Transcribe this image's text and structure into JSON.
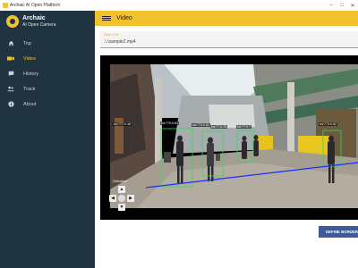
{
  "window": {
    "title": "Archaic AI Open Platform"
  },
  "brand": {
    "name": "Archaic",
    "subtitle": "AI Open Camera"
  },
  "nav": {
    "items": [
      {
        "label": "Top",
        "icon": "home-icon"
      },
      {
        "label": "Video",
        "icon": "video-icon",
        "active": true
      },
      {
        "label": "History",
        "icon": "chat-icon"
      },
      {
        "label": "Track",
        "icon": "people-icon"
      },
      {
        "label": "About",
        "icon": "info-icon"
      }
    ]
  },
  "topbar": {
    "title": "Video"
  },
  "video_file": {
    "label": "Video File",
    "value": ".\\.\\sample2.mp4"
  },
  "detections": [
    {
      "label": "bd:777:0.48"
    },
    {
      "label": "bd:779:0.81"
    },
    {
      "label": "bd:770:0.81"
    },
    {
      "label": "bd:77:0.75"
    },
    {
      "label": "bd:77:0.7"
    },
    {
      "label": "bd:773:0.62"
    }
  ],
  "direction": {
    "label": "Direction"
  },
  "buttons": {
    "define_border": "DEFINE BORDER"
  },
  "colors": {
    "accent": "#f2c12e",
    "sidebar": "#1f3340",
    "button": "#3d5a9e",
    "border_line": "#1a2cff"
  }
}
